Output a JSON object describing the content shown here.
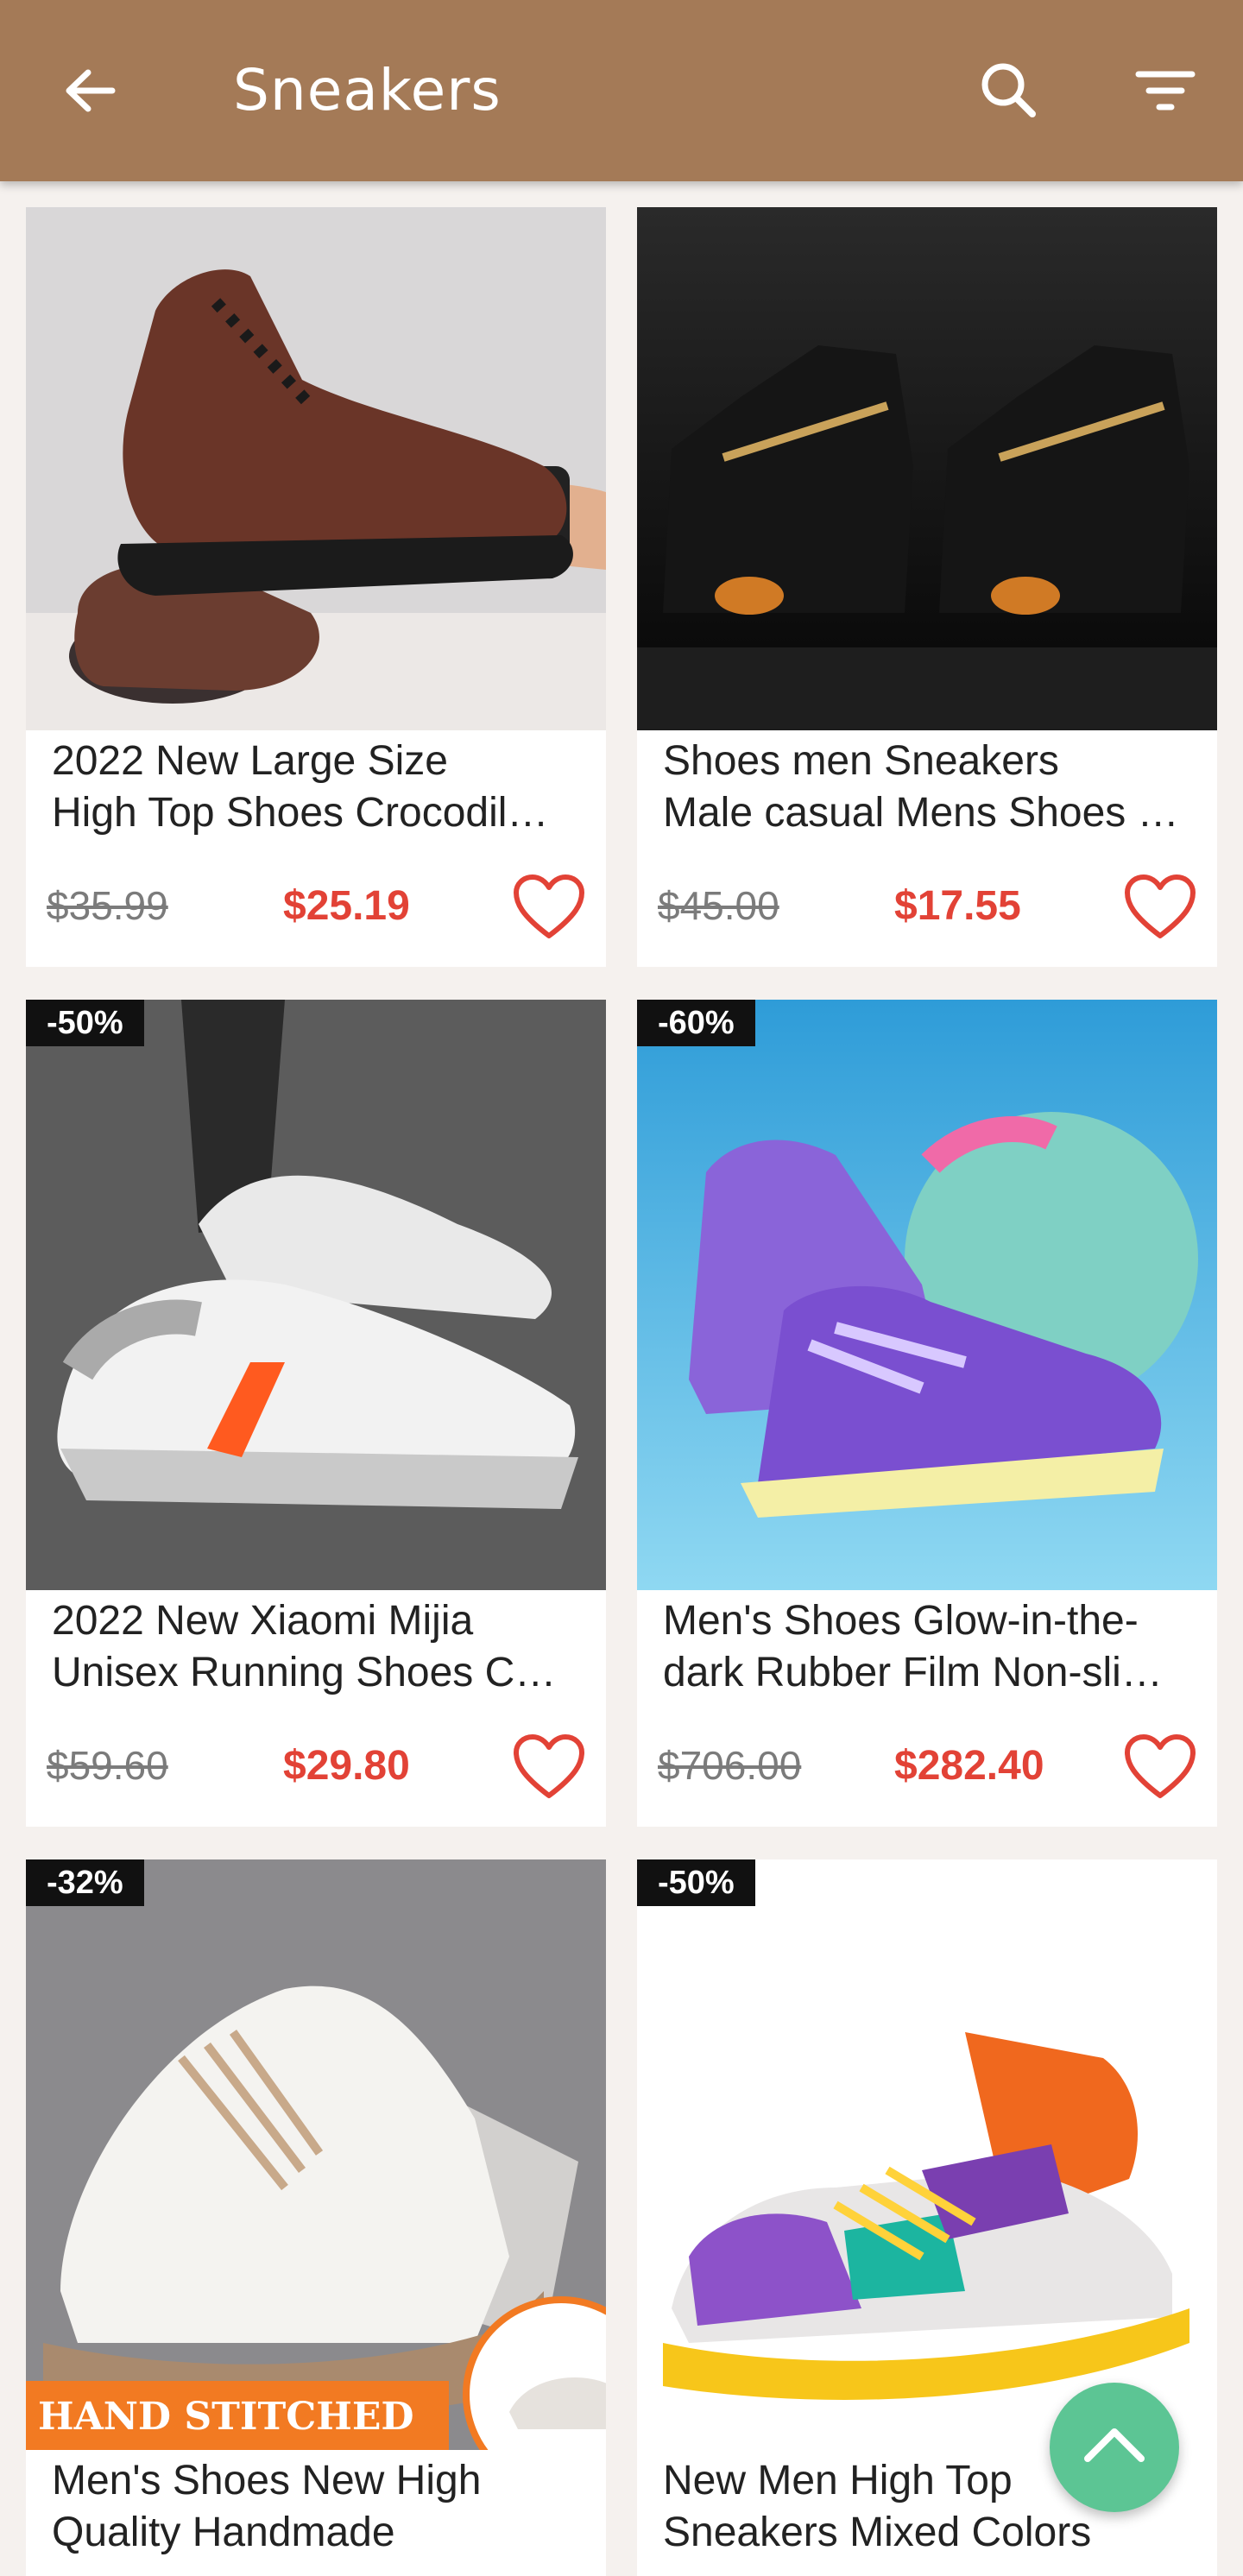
{
  "header": {
    "title": "Sneakers",
    "back_icon": "arrow-left-icon",
    "search_icon": "search-icon",
    "filter_icon": "filter-icon",
    "color": "#a47a57"
  },
  "products": [
    {
      "badge": "",
      "name_line1": "2022 New Large Size",
      "name_line2": "High Top Shoes Crocodile Pattern Men's Leather Casual Shoes",
      "old_price": "$35.99",
      "price": "$25.19"
    },
    {
      "badge": "",
      "name_line1": "Shoes men Sneakers",
      "name_line2": "Male casual Mens Shoes tenis Luxury shoes",
      "old_price": "$45.00",
      "price": "$17.55"
    },
    {
      "badge": "-50%",
      "name_line1": "2022 New Xiaomi Mijia",
      "name_line2": "Unisex Running Shoes Casual Sneakers",
      "old_price": "$59.60",
      "price": "$29.80"
    },
    {
      "badge": "-60%",
      "name_line1": "Men's Shoes Glow-in-the-",
      "name_line2": "dark Rubber Film Non-slip Basketball Shoes",
      "old_price": "$706.00",
      "price": "$282.40"
    },
    {
      "badge": "-32%",
      "image_banner": "HAND STITCHED",
      "name_line1": "Men's Shoes New High",
      "name_line2": "Quality Handmade",
      "old_price": "",
      "price": ""
    },
    {
      "badge": "-50%",
      "name_line1": "New Men High Top",
      "name_line2": "Sneakers Mixed Colors",
      "old_price": "",
      "price": ""
    }
  ],
  "colors": {
    "price": "#e24236",
    "fab": "#5cc594"
  },
  "fab_icon": "chevron-up-icon"
}
